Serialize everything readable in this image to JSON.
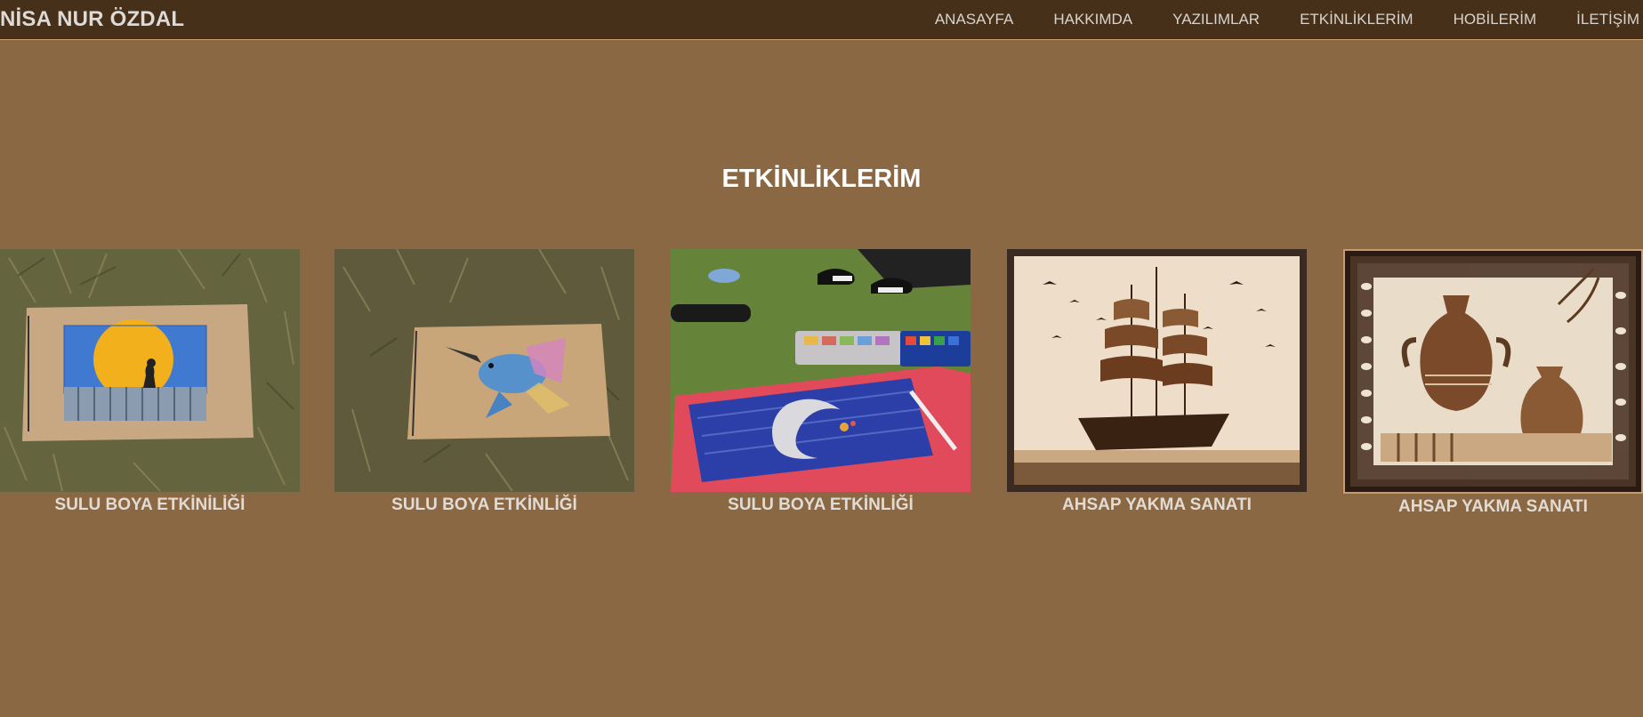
{
  "header": {
    "brand": "NİSA NUR ÖZDAL",
    "nav": [
      {
        "label": "ANASAYFA"
      },
      {
        "label": "HAKKIMDA"
      },
      {
        "label": "YAZILIMLAR"
      },
      {
        "label": "ETKİNLİKLERİM"
      },
      {
        "label": "HOBİLERİM"
      },
      {
        "label": "İLETİŞİM"
      }
    ]
  },
  "main": {
    "title": "ETKİNLİKLERİM",
    "cards": [
      {
        "caption": "SULU BOYA ETKİNİLİĞİ",
        "image": "watercolor-cat-moon-painting"
      },
      {
        "caption": "SULU BOYA ETKİNLİĞİ",
        "image": "watercolor-hummingbird-painting"
      },
      {
        "caption": "SULU BOYA ETKİNLİĞİ",
        "image": "watercolor-crescent-moon-painting"
      },
      {
        "caption": "AHSAP YAKMA SANATI",
        "image": "wood-burning-sailing-ship"
      },
      {
        "caption": "AHSAP YAKMA SANATI",
        "image": "wood-burning-vases"
      }
    ]
  },
  "colors": {
    "page_background": "#8b6844",
    "navbar_background": "#47301a",
    "title_text": "#ffffff",
    "caption_text": "#e1dbd4"
  }
}
